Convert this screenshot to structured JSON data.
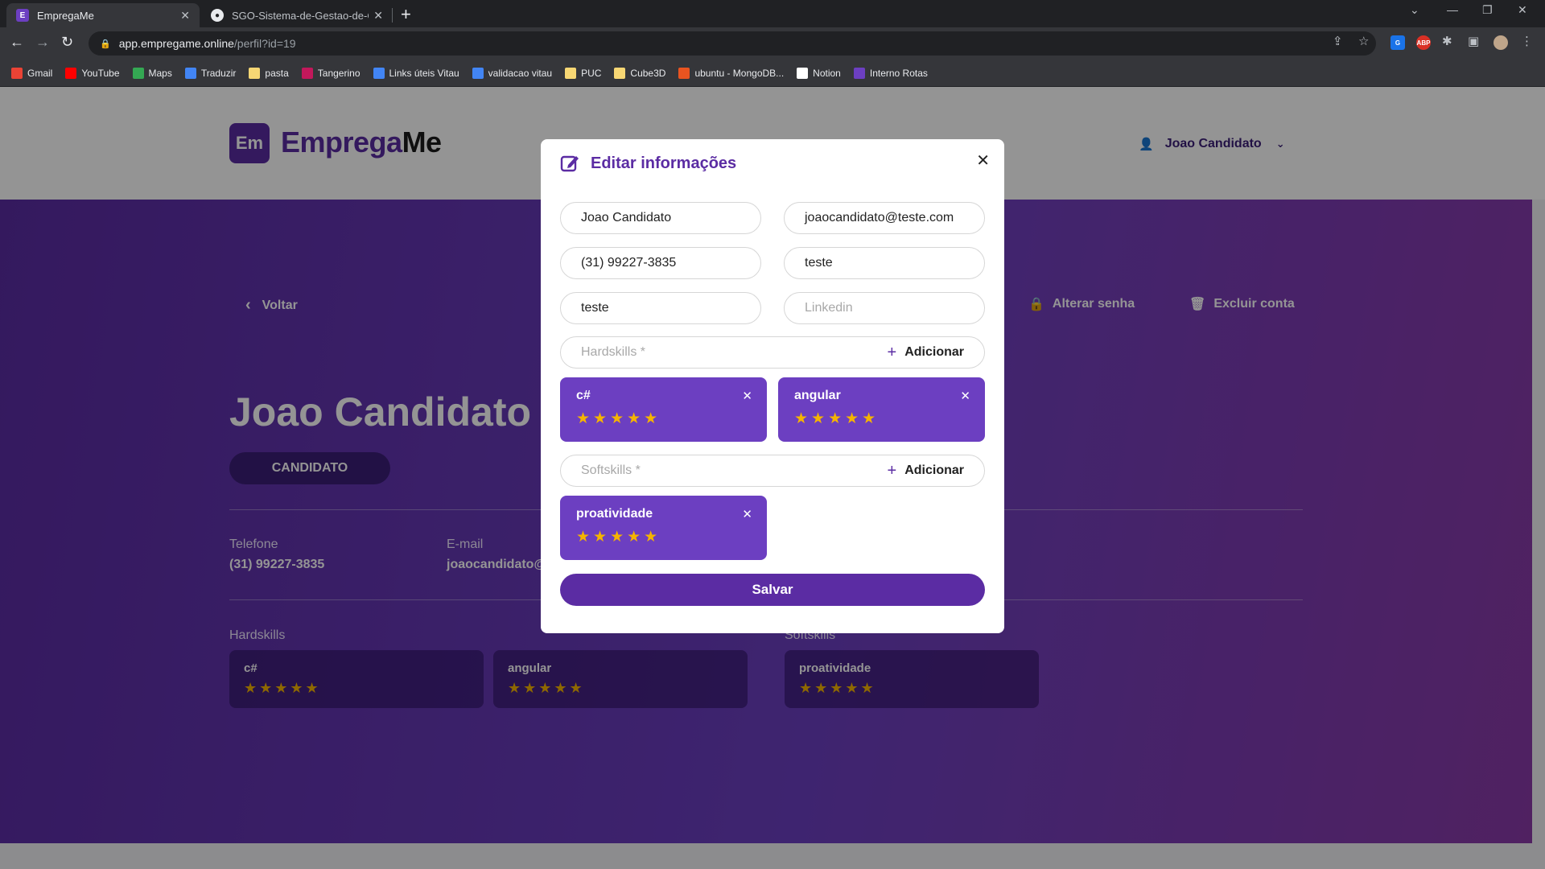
{
  "browser": {
    "tabs": [
      {
        "title": "EmpregaMe",
        "favicon_icon": "emprega-favicon-icon"
      },
      {
        "title": "SGO-Sistema-de-Gestao-de-ON",
        "favicon_icon": "github-icon"
      }
    ],
    "url_host": "app.empregame.online",
    "url_path": "/perfil?id=19",
    "bookmarks": [
      {
        "label": "Gmail",
        "icon": "gmail-icon"
      },
      {
        "label": "YouTube",
        "icon": "youtube-icon"
      },
      {
        "label": "Maps",
        "icon": "maps-icon"
      },
      {
        "label": "Traduzir",
        "icon": "translate-icon"
      },
      {
        "label": "pasta",
        "icon": "folder-icon"
      },
      {
        "label": "Tangerino",
        "icon": "tangerino-icon"
      },
      {
        "label": "Links úteis Vitau",
        "icon": "link-icon"
      },
      {
        "label": "validacao vitau",
        "icon": "link-icon"
      },
      {
        "label": "PUC",
        "icon": "folder-icon"
      },
      {
        "label": "Cube3D",
        "icon": "folder-icon"
      },
      {
        "label": "ubuntu - MongoDB...",
        "icon": "ubuntu-icon"
      },
      {
        "label": "Notion",
        "icon": "notion-icon"
      },
      {
        "label": "Interno Rotas",
        "icon": "rotas-icon"
      }
    ]
  },
  "header": {
    "logo_prefix": "Emprega",
    "logo_suffix": "Me",
    "logo_mark": "Em",
    "user_name": "Joao Candidato"
  },
  "profile": {
    "back_label": "Voltar",
    "change_password_label": "Alterar senha",
    "delete_account_label": "Excluir conta",
    "name": "Joao Candidato",
    "role": "CANDIDATO",
    "phone_label": "Telefone",
    "phone": "(31) 99227-3835",
    "email_label": "E-mail",
    "email": "joaocandidato@",
    "hardskills_label": "Hardskills",
    "softskills_label": "Softskills",
    "hardskills": [
      {
        "name": "c#",
        "rating": 5
      },
      {
        "name": "angular",
        "rating": 5
      }
    ],
    "softskills": [
      {
        "name": "proatividade",
        "rating": 5
      }
    ]
  },
  "modal": {
    "title": "Editar informações",
    "name_value": "Joao Candidato",
    "email_value": "joaocandidato@teste.com",
    "phone_value": "(31) 99227-3835",
    "field4_value": "teste",
    "field5_value": "teste",
    "linkedin_placeholder": "Linkedin",
    "hardskills_placeholder": "Hardskills *",
    "softskills_placeholder": "Softskills *",
    "add_label": "Adicionar",
    "hardskills": [
      {
        "name": "c#",
        "rating": 5
      },
      {
        "name": "angular",
        "rating": 5
      }
    ],
    "softskills": [
      {
        "name": "proatividade",
        "rating": 5
      }
    ],
    "save_label": "Salvar"
  },
  "colors": {
    "brand_purple": "#5b2ca3",
    "chip_purple": "#6c3fc1",
    "star": "#f5b400"
  }
}
